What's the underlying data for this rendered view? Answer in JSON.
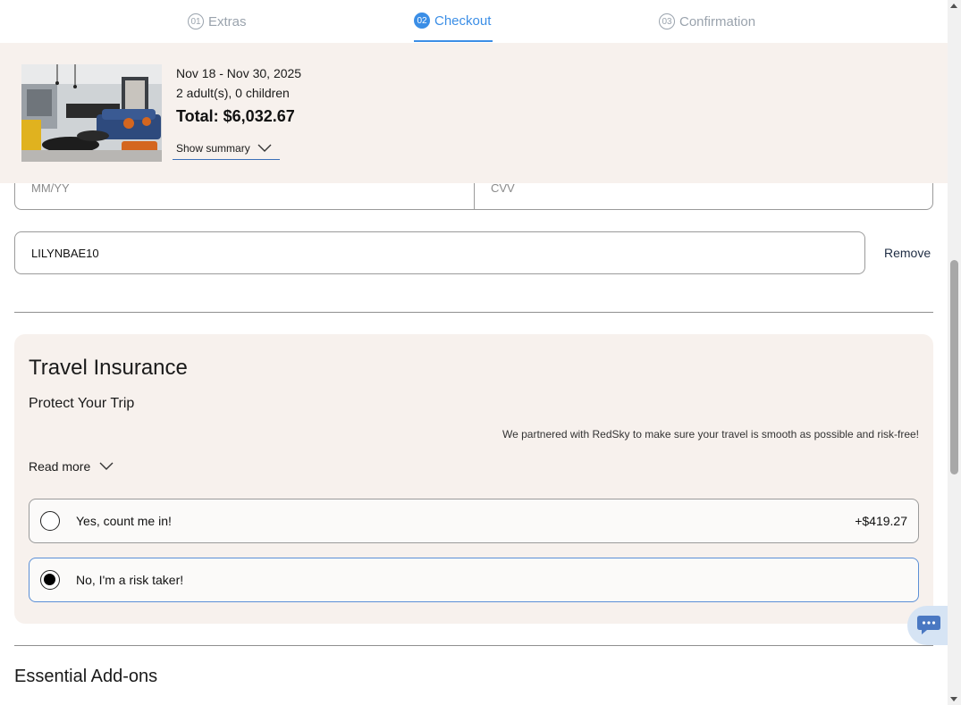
{
  "stepper": {
    "steps": [
      {
        "num": "01",
        "label": "Extras"
      },
      {
        "num": "02",
        "label": "Checkout"
      },
      {
        "num": "03",
        "label": "Confirmation"
      }
    ],
    "active_step": 2,
    "accent_color": "#3b8ee6"
  },
  "summary": {
    "dates": "Nov 18 - Nov 30, 2025",
    "guests": "2 adult(s), 0 children",
    "total": "Total: $6,032.67",
    "toggle_label": "Show summary",
    "thumbnail_icon": "property-photo"
  },
  "payment": {
    "expiry_placeholder": "MM/YY",
    "cvv_placeholder": "CVV",
    "expiry_value": "",
    "cvv_value": "",
    "promo_code_value": "LILYNBAE10",
    "remove_label": "Remove"
  },
  "insurance": {
    "title": "Travel Insurance",
    "subtitle": "Protect Your Trip",
    "note": "We partnered with RedSky to make sure your travel is smooth as possible and risk-free!",
    "read_more_label": "Read more",
    "options": [
      {
        "label": "Yes, count me in!",
        "price": "+$419.27",
        "selected": false
      },
      {
        "label": "No, I'm a risk taker!",
        "price": "",
        "selected": true
      }
    ]
  },
  "addons": {
    "title": "Essential Add-ons"
  },
  "chat": {
    "icon": "chat-bubble-icon"
  }
}
